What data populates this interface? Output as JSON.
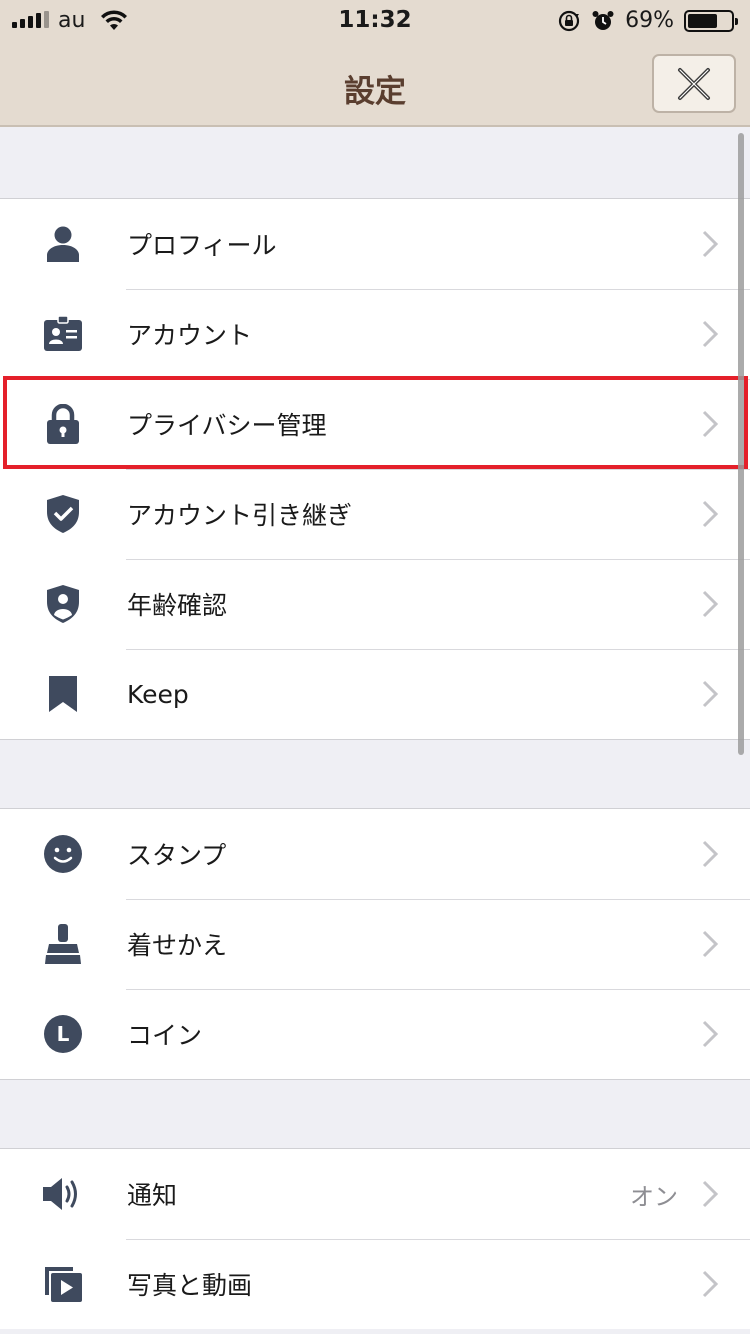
{
  "status_bar": {
    "carrier": "au",
    "time": "11:32",
    "battery_percent": "69%",
    "battery_level": 0.69
  },
  "nav": {
    "title": "設定",
    "close_icon": "close-icon"
  },
  "sections": [
    {
      "items": [
        {
          "label": "プロフィール",
          "icon": "person-icon"
        },
        {
          "label": "アカウント",
          "icon": "id-card-icon"
        },
        {
          "label": "プライバシー管理",
          "icon": "lock-icon",
          "highlighted": true
        },
        {
          "label": "アカウント引き継ぎ",
          "icon": "shield-check-icon"
        },
        {
          "label": "年齢確認",
          "icon": "shield-person-icon"
        },
        {
          "label": "Keep",
          "icon": "bookmark-icon"
        }
      ]
    },
    {
      "items": [
        {
          "label": "スタンプ",
          "icon": "smiley-icon"
        },
        {
          "label": "着せかえ",
          "icon": "brush-icon"
        },
        {
          "label": "コイン",
          "icon": "coin-icon",
          "coin_letter": "L"
        }
      ]
    },
    {
      "items": [
        {
          "label": "通知",
          "icon": "speaker-icon",
          "value": "オン"
        },
        {
          "label": "写真と動画",
          "icon": "photo-video-icon"
        }
      ]
    }
  ],
  "colors": {
    "nav_background": "#e4dbd0",
    "title_color": "#5a3e2f",
    "icon_color": "#3f4a5e",
    "highlight_border": "#e4202a",
    "list_background": "#efeff4"
  }
}
